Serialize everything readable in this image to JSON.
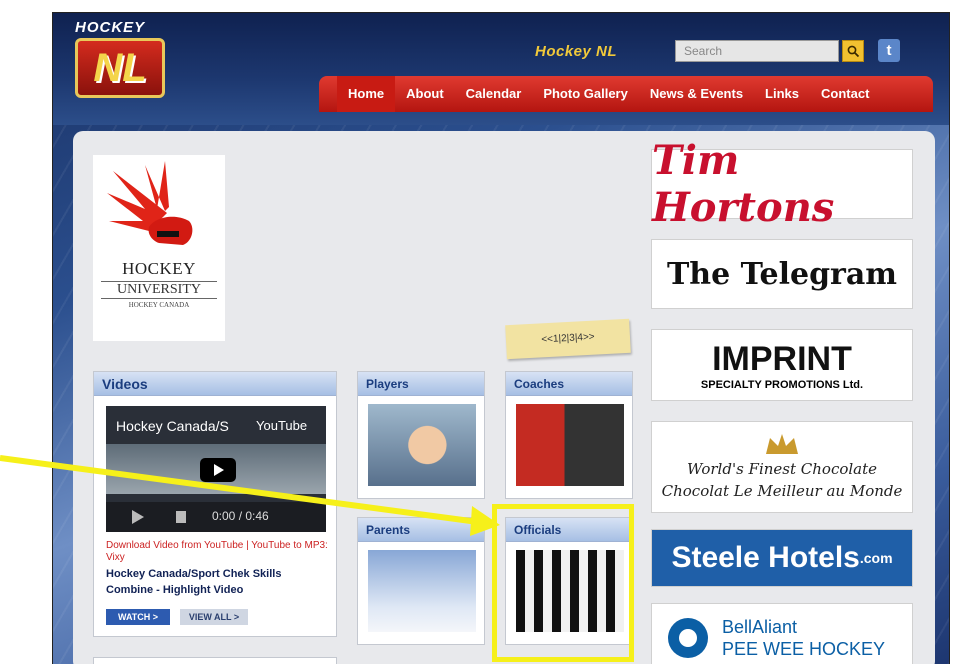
{
  "header": {
    "logo_top": "HOCKEY",
    "logo_mark": "NL",
    "site_name": "Hockey NL",
    "search_placeholder": "Search",
    "twitter_glyph": "t"
  },
  "nav": {
    "items": [
      "Home",
      "About",
      "Calendar",
      "Photo Gallery",
      "News & Events",
      "Links",
      "Contact"
    ],
    "active": "Home"
  },
  "hockey_university": {
    "line1": "HOCKEY",
    "line2": "UNIVERSITY",
    "line3": "HOCKEY CANADA"
  },
  "pager": {
    "text": "<<1|2|3|4>>"
  },
  "videos": {
    "header": "Videos",
    "player_title": "Hockey Canada/S",
    "player_brand": "YouTube",
    "time": "0:00 / 0:46",
    "download_text": "Download Video from YouTube | YouTube to MP3: Vixy",
    "video_title": "Hockey Canada/Sport Chek Skills Combine - Highlight Video",
    "watch_label": "WATCH >",
    "view_all_label": "VIEW ALL >"
  },
  "sections": [
    {
      "label": "Players"
    },
    {
      "label": "Coaches"
    },
    {
      "label": "Parents"
    },
    {
      "label": "Officials"
    }
  ],
  "sponsors": {
    "tim": "Tim Hortons",
    "telegram": "The Telegram",
    "imprint": "IMPRINT",
    "imprint_sub": "SPECIALTY PROMOTIONS Ltd.",
    "wf_line1": "World's Finest Chocolate",
    "wf_line2": "Chocolat Le Meilleur au Monde",
    "steele": "Steele Hotels",
    "steele_sub": ".com",
    "bell1": "BellAliant",
    "bell2": "PEE WEE HOCKEY"
  },
  "colors": {
    "nav_red": "#c81b13",
    "highlight_yellow": "#f6f01a",
    "panel_header_text": "#1b3d7f"
  }
}
